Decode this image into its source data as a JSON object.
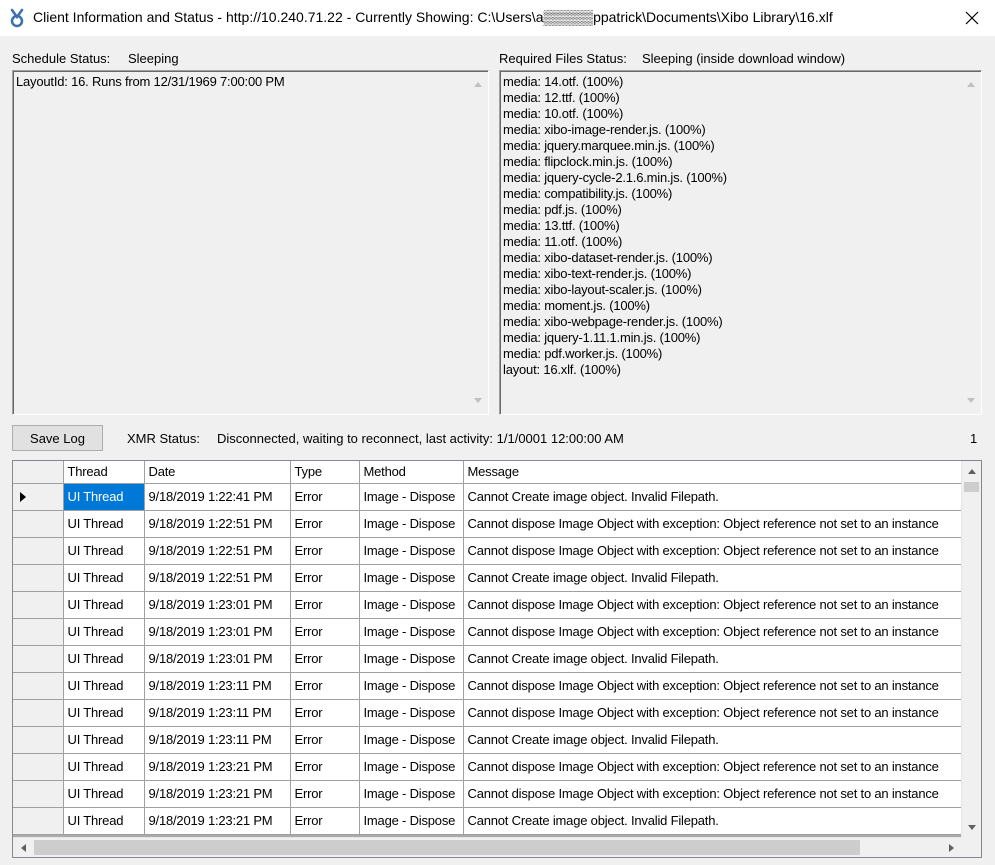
{
  "window": {
    "title": "Client Information and Status - http://10.240.71.22 - Currently Showing: C:\\Users\\a▒▒▒▒▒ppatrick\\Documents\\Xibo Library\\16.xlf"
  },
  "schedule": {
    "label": "Schedule Status:",
    "value": "Sleeping",
    "lines": [
      "LayoutId: 16. Runs from 12/31/1969 7:00:00 PM"
    ]
  },
  "required_files": {
    "label": "Required Files Status:",
    "value": "Sleeping (inside download window)",
    "lines": [
      "media: 14.otf. (100%)",
      "media: 12.ttf. (100%)",
      "media: 10.otf. (100%)",
      "media: xibo-image-render.js. (100%)",
      "media: jquery.marquee.min.js. (100%)",
      "media: flipclock.min.js. (100%)",
      "media: jquery-cycle-2.1.6.min.js. (100%)",
      "media: compatibility.js. (100%)",
      "media: pdf.js. (100%)",
      "media: 13.ttf. (100%)",
      "media: 11.otf. (100%)",
      "media: xibo-dataset-render.js. (100%)",
      "media: xibo-text-render.js. (100%)",
      "media: xibo-layout-scaler.js. (100%)",
      "media: moment.js. (100%)",
      "media: xibo-webpage-render.js. (100%)",
      "media: jquery-1.11.1.min.js. (100%)",
      "media: pdf.worker.js. (100%)",
      "layout: 16.xlf. (100%)"
    ]
  },
  "toolbar": {
    "save_log_label": "Save Log",
    "xmr_label": "XMR Status:",
    "xmr_value": "Disconnected, waiting to reconnect, last activity: 1/1/0001 12:00:00 AM",
    "count": "1"
  },
  "log": {
    "columns": [
      "Thread",
      "Date",
      "Type",
      "Method",
      "Message"
    ],
    "rows": [
      [
        "UI Thread",
        "9/18/2019 1:22:41 PM",
        "Error",
        "Image - Dispose",
        "Cannot Create image object. Invalid Filepath."
      ],
      [
        "UI Thread",
        "9/18/2019 1:22:51 PM",
        "Error",
        "Image - Dispose",
        "Cannot dispose Image Object with exception: Object reference not set to an instance"
      ],
      [
        "UI Thread",
        "9/18/2019 1:22:51 PM",
        "Error",
        "Image - Dispose",
        "Cannot dispose Image Object with exception: Object reference not set to an instance"
      ],
      [
        "UI Thread",
        "9/18/2019 1:22:51 PM",
        "Error",
        "Image - Dispose",
        "Cannot Create image object. Invalid Filepath."
      ],
      [
        "UI Thread",
        "9/18/2019 1:23:01 PM",
        "Error",
        "Image - Dispose",
        "Cannot dispose Image Object with exception: Object reference not set to an instance"
      ],
      [
        "UI Thread",
        "9/18/2019 1:23:01 PM",
        "Error",
        "Image - Dispose",
        "Cannot dispose Image Object with exception: Object reference not set to an instance"
      ],
      [
        "UI Thread",
        "9/18/2019 1:23:01 PM",
        "Error",
        "Image - Dispose",
        "Cannot Create image object. Invalid Filepath."
      ],
      [
        "UI Thread",
        "9/18/2019 1:23:11 PM",
        "Error",
        "Image - Dispose",
        "Cannot dispose Image Object with exception: Object reference not set to an instance"
      ],
      [
        "UI Thread",
        "9/18/2019 1:23:11 PM",
        "Error",
        "Image - Dispose",
        "Cannot dispose Image Object with exception: Object reference not set to an instance"
      ],
      [
        "UI Thread",
        "9/18/2019 1:23:11 PM",
        "Error",
        "Image - Dispose",
        "Cannot Create image object. Invalid Filepath."
      ],
      [
        "UI Thread",
        "9/18/2019 1:23:21 PM",
        "Error",
        "Image - Dispose",
        "Cannot dispose Image Object with exception: Object reference not set to an instance"
      ],
      [
        "UI Thread",
        "9/18/2019 1:23:21 PM",
        "Error",
        "Image - Dispose",
        "Cannot dispose Image Object with exception: Object reference not set to an instance"
      ],
      [
        "UI Thread",
        "9/18/2019 1:23:21 PM",
        "Error",
        "Image - Dispose",
        "Cannot Create image object. Invalid Filepath."
      ]
    ],
    "selected_row": 0
  },
  "icons": {
    "app": "xibo-app-icon",
    "close": "close-icon",
    "current_row": "row-pointer-icon"
  },
  "colors": {
    "selection": "#0078d7",
    "window_bg": "#f0f0f0"
  }
}
